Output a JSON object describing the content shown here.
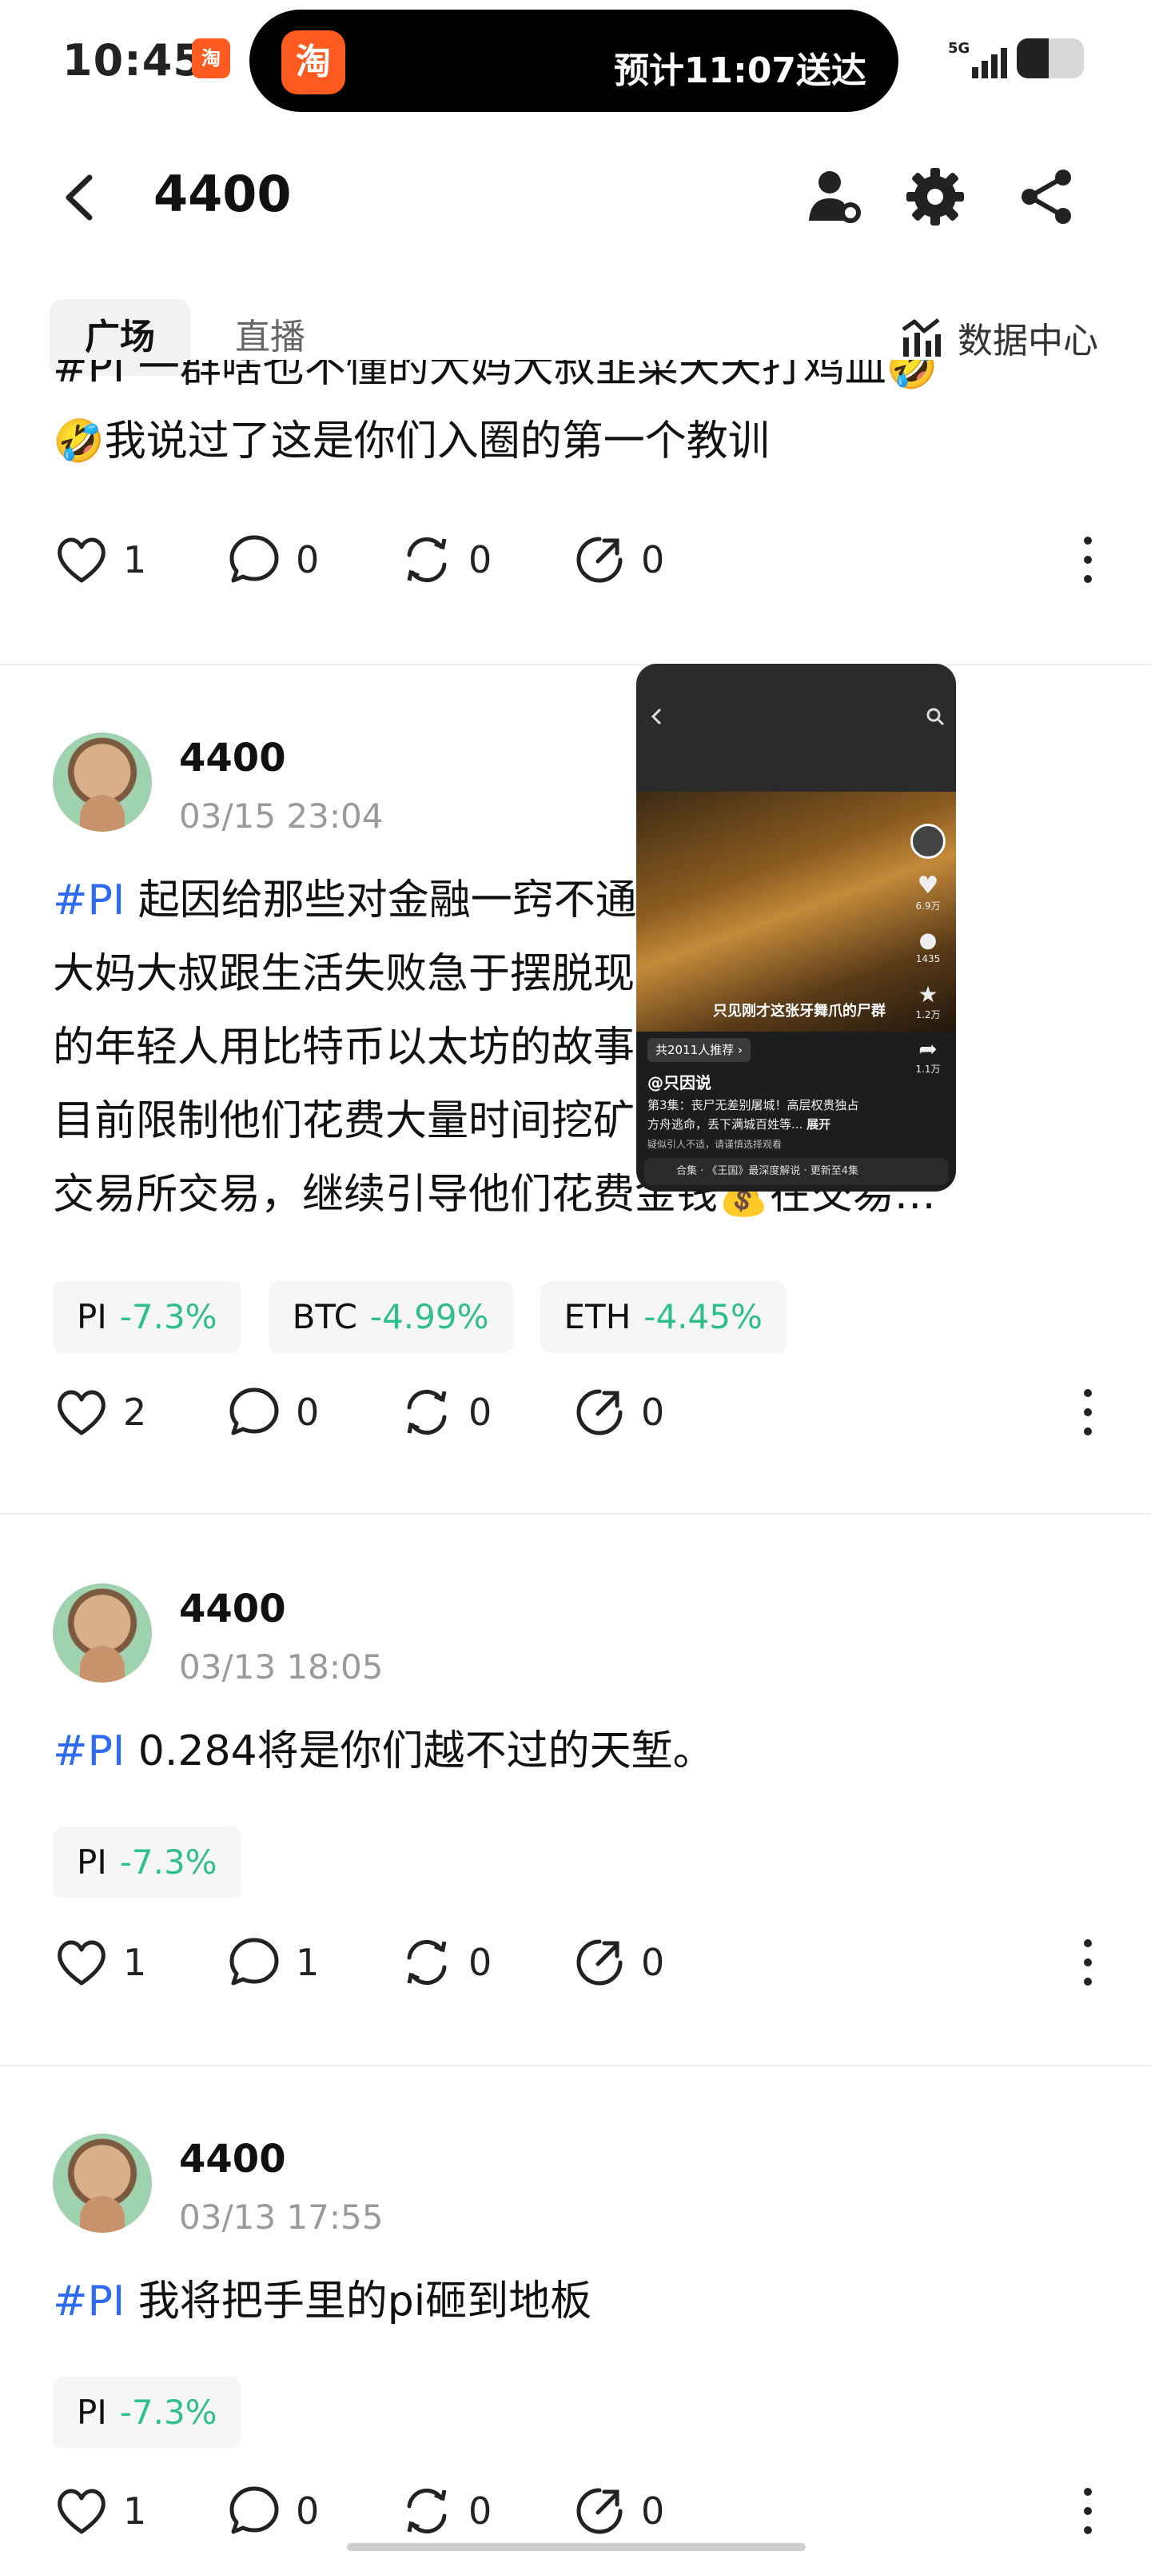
{
  "status_bar": {
    "time": "10:45",
    "island_app_glyph": "淘",
    "island_text": "预计11:07送达",
    "network": "5G"
  },
  "header": {
    "title": "4400",
    "icons": [
      "back-icon",
      "user-settings-icon",
      "gear-icon",
      "share-icon"
    ]
  },
  "tabs": {
    "square": "广场",
    "live": "直播",
    "data_center": "数据中心"
  },
  "posts": [
    {
      "text_top": "#PI 一群啥也不懂的大妈大叔韭菜天天打鸡血🤣",
      "text_line": "🤣我说过了这是你们入圈的第一个教训",
      "likes": "1",
      "comments": "0",
      "reposts": "0",
      "shares": "0"
    },
    {
      "author": "4400",
      "time": "03/15 23:04",
      "tag": "#PI",
      "lines": [
        "起因给那些对金融一窍不通或者不熟悉的",
        "大妈大叔跟生活失败急于摆脱现状的暴富",
        "的年轻人用比特币以太坊的故事画饼，到",
        "目前限制他们花费大量时间挖矿然后提到",
        "交易所交易，继续引导他们花费金钱💰在交易…"
      ],
      "chips": [
        {
          "symbol": "PI",
          "change": "-7.3%"
        },
        {
          "symbol": "BTC",
          "change": "-4.99%"
        },
        {
          "symbol": "ETH",
          "change": "-4.45%"
        }
      ],
      "likes": "2",
      "comments": "0",
      "reposts": "0",
      "shares": "0"
    },
    {
      "author": "4400",
      "time": "03/13 18:05",
      "tag": "#PI",
      "text": "0.284将是你们越不过的天堑。",
      "chips": [
        {
          "symbol": "PI",
          "change": "-7.3%"
        }
      ],
      "likes": "1",
      "comments": "1",
      "reposts": "0",
      "shares": "0"
    },
    {
      "author": "4400",
      "time": "03/13 17:55",
      "tag": "#PI",
      "text": "我将把手里的pi砸到地板",
      "chips": [
        {
          "symbol": "PI",
          "change": "-7.3%"
        }
      ],
      "likes": "1",
      "comments": "0",
      "reposts": "0",
      "shares": "0"
    }
  ],
  "pip": {
    "subtitle": "只见刚才这张牙舞爪的尸群",
    "recommend": "共2011人推荐 ›",
    "author": "@只因说",
    "desc": "第3集：丧尸无差别屠城！高层权贵独占方舟逃命，丢下满城百姓等...",
    "expand": "展开",
    "note": "疑似引人不适，请谨慎选择观看",
    "bar": "合集 · 《王国》最深度解说 · 更新至4集",
    "counts": [
      "6.9万",
      "1435",
      "1.2万",
      "1.1万"
    ]
  },
  "colors": {
    "hashtag": "#2d6bf0",
    "negative_change": "#2fbf8a",
    "brand_orange": "#ff5a1f"
  }
}
